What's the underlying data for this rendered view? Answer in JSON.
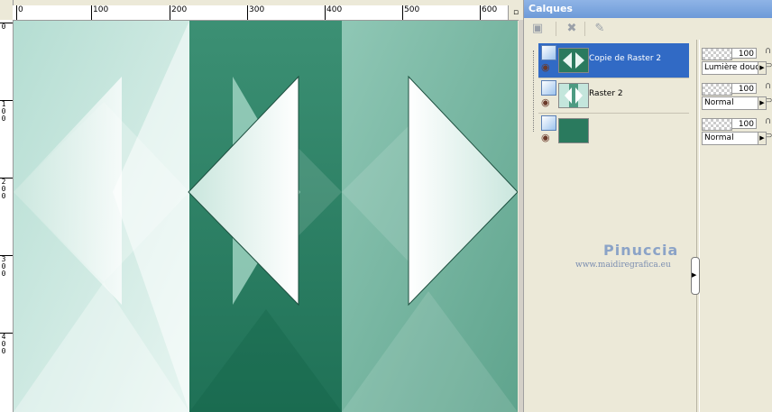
{
  "ruler": {
    "top_labels": [
      "0",
      "100",
      "200",
      "300",
      "400",
      "500",
      "600"
    ],
    "left_labels": [
      "0",
      "1 0 0",
      "2 0 0",
      "3 0 0",
      "4 0 0"
    ]
  },
  "palette": {
    "title": "Calques",
    "layers": [
      {
        "name": "Copie de Raster 2",
        "selected": true,
        "opacity": "100",
        "blend": "Lumière douce"
      },
      {
        "name": "Raster 2",
        "selected": false,
        "opacity": "100",
        "blend": "Normal"
      },
      {
        "name": "",
        "selected": false,
        "opacity": "100",
        "blend": "Normal"
      }
    ]
  },
  "watermark": {
    "name": "Pinuccia",
    "url": "www.maidiregrafica.eu"
  },
  "colors": {
    "dark_green": "#2a7a5e",
    "mid_green": "#6fb39b",
    "light_mint": "#c4e6dc",
    "selection_blue": "#316ac5"
  }
}
